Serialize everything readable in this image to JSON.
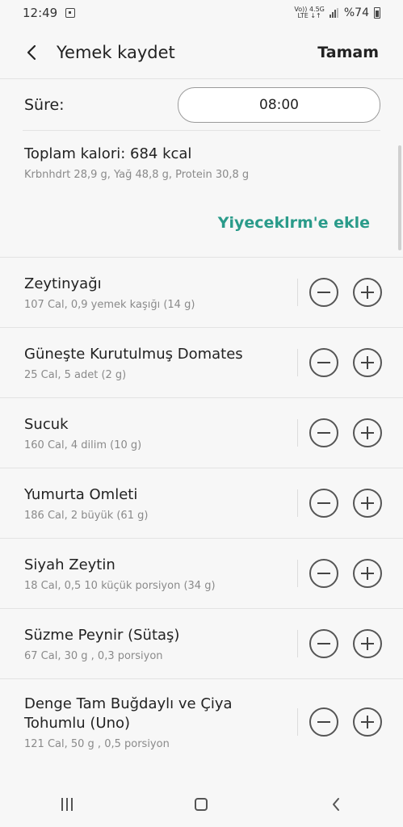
{
  "status": {
    "time": "12:49",
    "net_top": "Vo)) 4.5G",
    "net_bottom": "LTE ↓↑",
    "battery": "%74"
  },
  "header": {
    "title": "Yemek kaydet",
    "done_label": "Tamam"
  },
  "time_row": {
    "label": "Süre:",
    "value": "08:00"
  },
  "summary": {
    "title": "Toplam kalori: 684 kcal",
    "subtitle": "Krbnhdrt 28,9 g, Yağ 48,8 g, Protein 30,8 g"
  },
  "add_link": "Yiyeceklrm'e ekle",
  "items": [
    {
      "name": "Zeytinyağı",
      "detail": "107 Cal, 0,9 yemek kaşığı (14 g)"
    },
    {
      "name": "Güneşte Kurutulmuş Domates",
      "detail": "25 Cal, 5 adet (2 g)"
    },
    {
      "name": "Sucuk",
      "detail": "160 Cal, 4 dilim (10 g)"
    },
    {
      "name": "Yumurta Omleti",
      "detail": "186 Cal, 2 büyük (61 g)"
    },
    {
      "name": "Siyah Zeytin",
      "detail": "18 Cal, 0,5 10 küçük porsiyon (34 g)"
    },
    {
      "name": "Süzme Peynir (Sütaş)",
      "detail": "67 Cal, 30 g , 0,3 porsiyon"
    },
    {
      "name": "Denge Tam Buğdaylı ve Çiya Tohumlu (Uno)",
      "detail": "121 Cal, 50 g , 0,5 porsiyon"
    }
  ],
  "colors": {
    "accent": "#2a9b8a",
    "background": "#f7f7f7"
  }
}
